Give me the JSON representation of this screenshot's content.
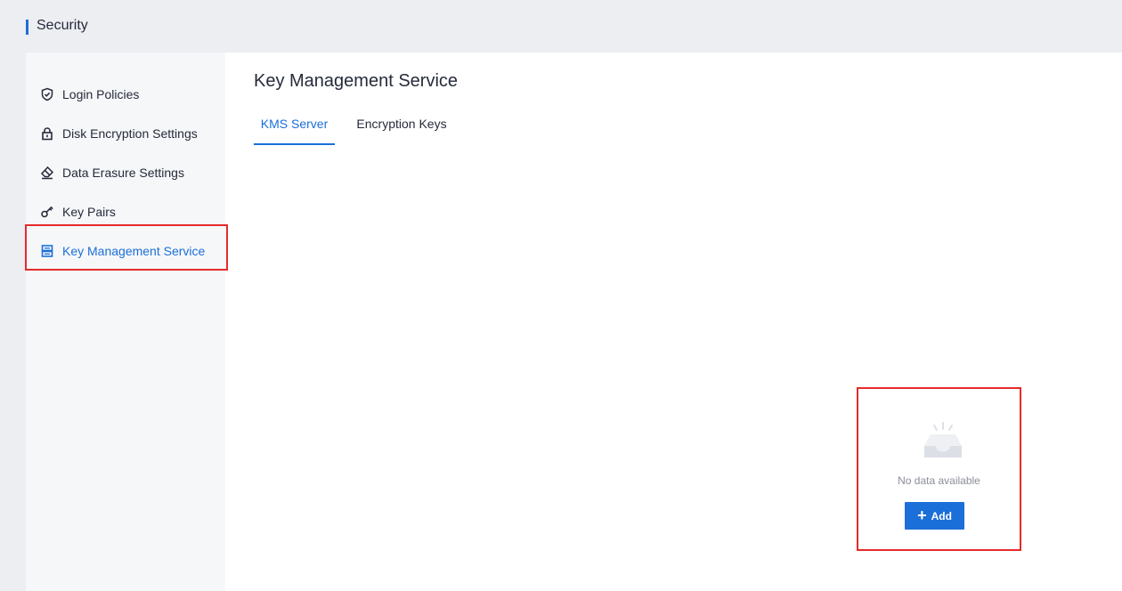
{
  "header": {
    "title": "Security",
    "accent_color": "#1b6fd8"
  },
  "sidebar": {
    "items": [
      {
        "label": "Login Policies",
        "icon": "shield-icon"
      },
      {
        "label": "Disk Encryption Settings",
        "icon": "lock-icon"
      },
      {
        "label": "Data Erasure Settings",
        "icon": "eraser-icon"
      },
      {
        "label": "Key Pairs",
        "icon": "key-icon"
      },
      {
        "label": "Key Management Service",
        "icon": "server-icon",
        "active": true
      }
    ]
  },
  "main": {
    "title": "Key Management Service",
    "tabs": [
      {
        "label": "KMS Server",
        "active": true
      },
      {
        "label": "Encryption Keys",
        "active": false
      }
    ],
    "empty_state": {
      "icon": "empty-inbox-icon",
      "message": "No data available",
      "add_button_label": "Add",
      "add_button_icon": "plus-icon"
    }
  },
  "colors": {
    "primary": "#1b6fd8",
    "highlight": "#e52b2b"
  }
}
